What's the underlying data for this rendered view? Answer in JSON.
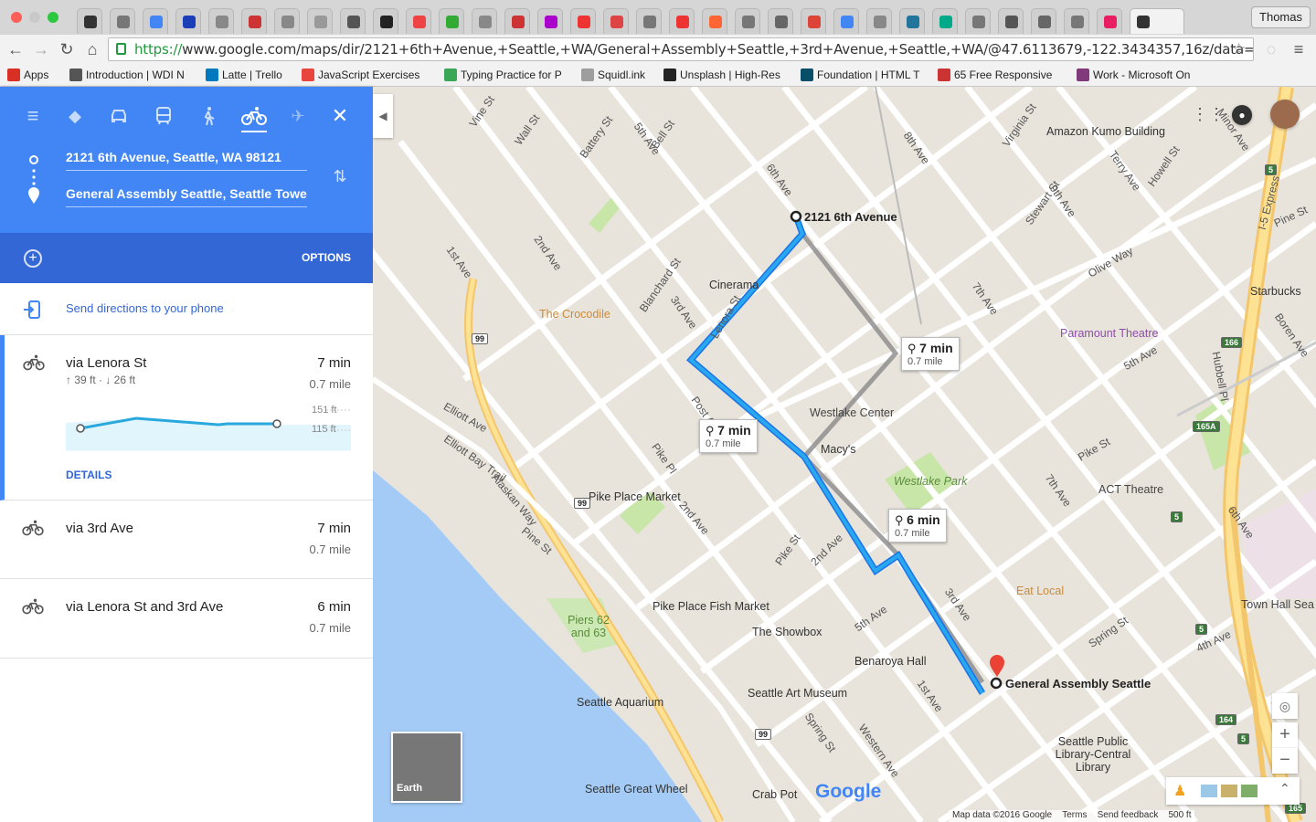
{
  "browser": {
    "user_name": "Thomas",
    "url_scheme": "https://",
    "url_rest": "www.google.com/maps/dir/2121+6th+Avenue,+Seattle,+WA/General+Assembly+Seattle,+3rd+Avenue,+Seattle,+WA/@47.6113679,-122.3434357,16z/data=!3m1!4b1!4m14...",
    "bookmarks": [
      {
        "label": "Apps",
        "color": "#d93025"
      },
      {
        "label": "Introduction | WDI N",
        "color": "#555555"
      },
      {
        "label": "Latte | Trello",
        "color": "#0079bf"
      },
      {
        "label": "JavaScript Exercises",
        "color": "#e8453c"
      },
      {
        "label": "Typing Practice for P",
        "color": "#3aa757"
      },
      {
        "label": "Squidl.ink",
        "color": "#9e9e9e"
      },
      {
        "label": "Unsplash | High-Res",
        "color": "#222222"
      },
      {
        "label": "Foundation | HTML T",
        "color": "#074e68"
      },
      {
        "label": "65 Free Responsive",
        "color": "#cc3333"
      },
      {
        "label": "Work - Microsoft On",
        "color": "#80397b"
      }
    ]
  },
  "directions": {
    "origin": "2121 6th Avenue, Seattle, WA 98121",
    "destination": "General Assembly Seattle, Seattle Tower",
    "options_label": "OPTIONS",
    "send_label": "Send directions to your phone",
    "routes": [
      {
        "name": "via Lenora St",
        "time": "7 min",
        "distance": "0.7 mile",
        "elevation": "↑ 39 ft · ↓ 26 ft",
        "elev_high": "151 ft",
        "elev_low": "115 ft",
        "details": "DETAILS"
      },
      {
        "name": "via 3rd Ave",
        "time": "7 min",
        "distance": "0.7 mile"
      },
      {
        "name": "via Lenora St and 3rd Ave",
        "time": "6 min",
        "distance": "0.7 mile"
      }
    ]
  },
  "map": {
    "origin_label": "2121 6th Avenue",
    "destination_label": "General Assembly Seattle",
    "callouts": [
      {
        "time": "7 min",
        "distance": "0.7 mile"
      },
      {
        "time": "7 min",
        "distance": "0.7 mile"
      },
      {
        "time": "6 min",
        "distance": "0.7 mile"
      }
    ],
    "places": [
      "Amazon Kumo Building",
      "Cinerama",
      "The Crocodile",
      "Starbucks",
      "Paramount Theatre",
      "Westlake Center",
      "Macy's",
      "Westlake Park",
      "ACT Theatre",
      "Pike Place Market",
      "Pike Place Fish Market",
      "Eat Local",
      "Town Hall Sea",
      "The Showbox",
      "Benaroya Hall",
      "Seattle Art Museum",
      "Seattle Aquarium",
      "Seattle Public Library-Central Library",
      "Seattle Great Wheel",
      "Crab Pot",
      "Piers 62 and 63"
    ],
    "streets": [
      "Vine St",
      "Wall St",
      "Battery St",
      "Bell St",
      "5th Ave",
      "6th Ave",
      "8th Ave",
      "Virginia St",
      "Stewart St",
      "9th Ave",
      "Terry Ave",
      "Howell St",
      "Minor Ave",
      "I-5 Express",
      "Pine St",
      "Olive Way",
      "7th Ave",
      "Boren Ave",
      "Hubbell Pl",
      "4th Ave",
      "Blanchard St",
      "3rd Ave",
      "2nd Ave",
      "1st Ave",
      "Lenora St",
      "5th Ave",
      "Elliott Ave",
      "Elliott Bay Trail",
      "Alaskan Way",
      "Post Alley",
      "Pike Pl",
      "Pine St",
      "2nd Ave",
      "Pike St",
      "3rd Ave",
      "4th Ave",
      "Spring St",
      "Western Ave",
      "1st Ave",
      "2nd Ave",
      "5th Ave",
      "Spring St",
      "Pike St",
      "6th Ave",
      "7th Ave"
    ],
    "earth_label": "Earth",
    "logo": "Google",
    "footer": [
      "Map data ©2016 Google",
      "Terms",
      "Send feedback",
      "500 ft"
    ],
    "highway_shields": [
      "99",
      "99",
      "99",
      "5",
      "5",
      "5",
      "5",
      "166",
      "165A",
      "164",
      "165"
    ]
  }
}
